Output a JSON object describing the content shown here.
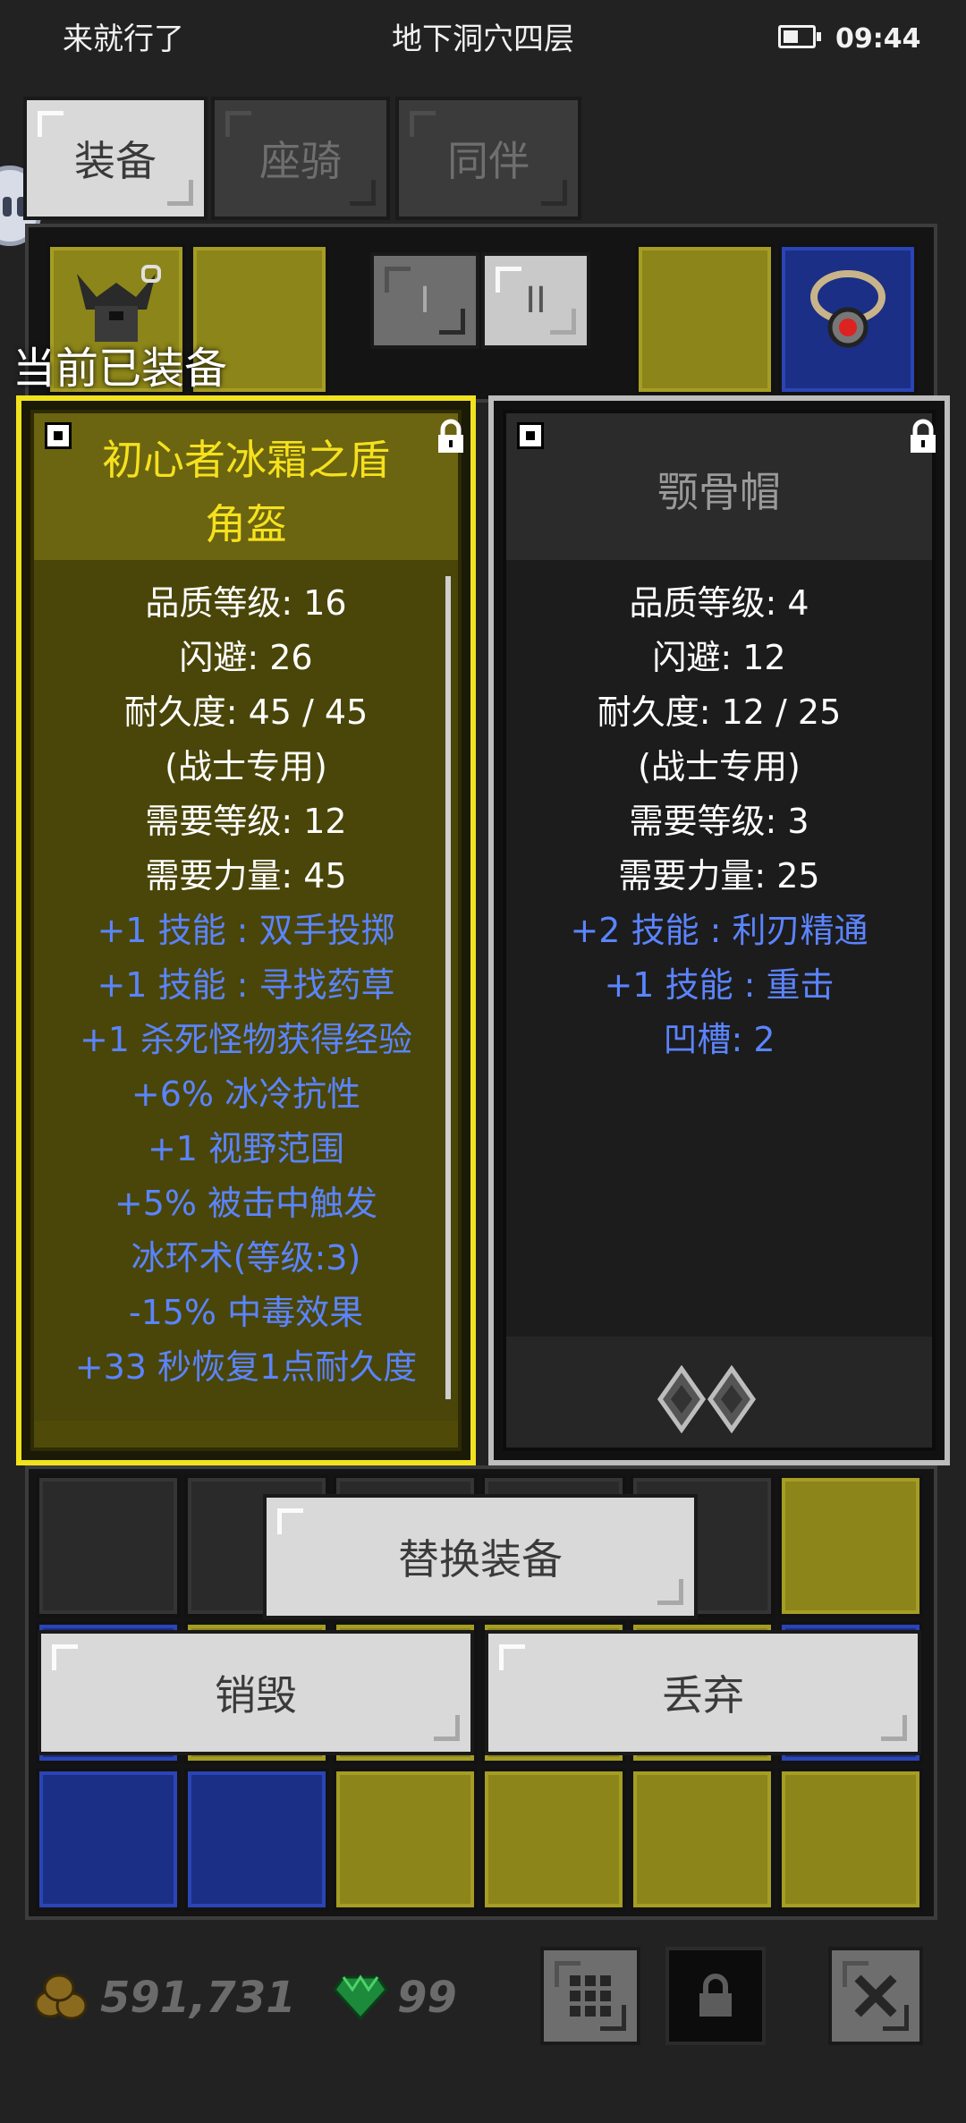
{
  "status_bar": {
    "left_text": "来就行了",
    "center_text": "地下洞穴四层",
    "time": "09:44"
  },
  "tabs": [
    {
      "label": "装备",
      "active": true
    },
    {
      "label": "座骑",
      "active": false
    },
    {
      "label": "同伴",
      "active": false
    }
  ],
  "loadout_buttons": [
    "I",
    "II"
  ],
  "section_label": "当前已装备",
  "left_card": {
    "title_line1": "初心者冰霜之盾",
    "title_line2": "角盔",
    "title_color": "#f5e11e",
    "stats": [
      {
        "text": "品质等级: 16",
        "type": "base"
      },
      {
        "text": "闪避: 26",
        "type": "base"
      },
      {
        "text": "耐久度: 45 / 45",
        "type": "base"
      },
      {
        "text": "(战士专用)",
        "type": "base"
      },
      {
        "text": "需要等级: 12",
        "type": "base"
      },
      {
        "text": "需要力量: 45",
        "type": "base"
      },
      {
        "text": "+1 技能 : 双手投掷",
        "type": "magic"
      },
      {
        "text": "+1 技能 : 寻找药草",
        "type": "magic"
      },
      {
        "text": "+1 杀死怪物获得经验",
        "type": "magic"
      },
      {
        "text": "+6% 冰冷抗性",
        "type": "magic"
      },
      {
        "text": "+1 视野范围",
        "type": "magic"
      },
      {
        "text": "+5% 被击中触发",
        "type": "magic"
      },
      {
        "text": "冰环术(等级:3)",
        "type": "magic"
      },
      {
        "text": "-15% 中毒效果",
        "type": "magic"
      },
      {
        "text": "+33 秒恢复1点耐久度",
        "type": "magic"
      }
    ]
  },
  "right_card": {
    "title": "颚骨帽",
    "title_color": "#9a9a9a",
    "stats": [
      {
        "text": "品质等级: 4",
        "type": "base"
      },
      {
        "text": "闪避: 12",
        "type": "base"
      },
      {
        "text": "耐久度: 12 / 25",
        "type": "base"
      },
      {
        "text": "(战士专用)",
        "type": "base"
      },
      {
        "text": "需要等级: 3",
        "type": "base"
      },
      {
        "text": "需要力量: 25",
        "type": "base"
      },
      {
        "text": "+2 技能 : 利刃精通",
        "type": "magic"
      },
      {
        "text": "+1 技能 : 重击",
        "type": "magic"
      },
      {
        "text": "凹槽: 2",
        "type": "magic"
      }
    ],
    "sockets": 2
  },
  "actions": {
    "replace": "替换装备",
    "destroy": "销毁",
    "discard": "丢弃"
  },
  "currency": {
    "gold": "591,731",
    "gems": "99"
  },
  "colors": {
    "base_stat": "#ffffff",
    "magic_stat": "#5b84ff",
    "unique_frame": "#f1e21e",
    "normal_frame": "#bdbdbd"
  }
}
